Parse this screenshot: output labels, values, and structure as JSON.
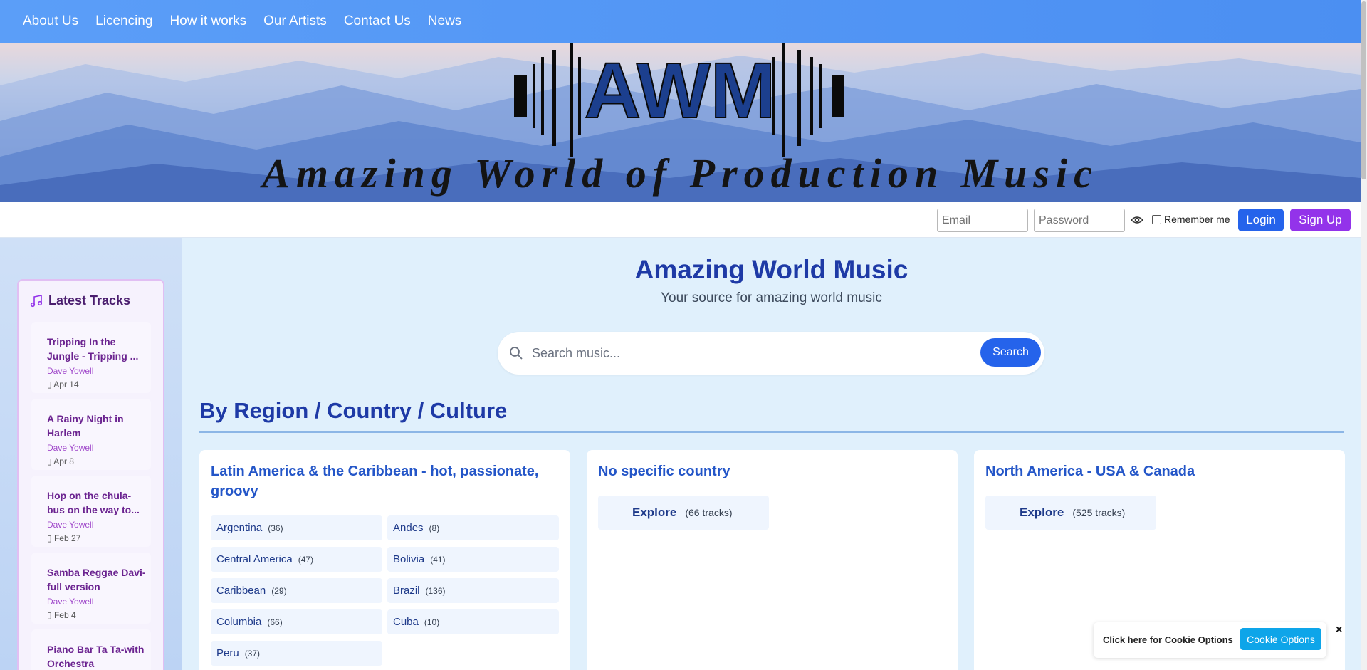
{
  "nav": {
    "items": [
      "About Us",
      "Licencing",
      "How it works",
      "Our Artists",
      "Contact Us",
      "News"
    ]
  },
  "banner": {
    "logo_letters": "AWM",
    "title": "Amazing World of Production Music"
  },
  "login": {
    "email_placeholder": "Email",
    "password_placeholder": "Password",
    "remember_label": "Remember me",
    "login_label": "Login",
    "signup_label": "Sign Up"
  },
  "sidebar": {
    "title": "Latest Tracks",
    "tracks": [
      {
        "title": "Tripping In the Jungle - Tripping ...",
        "artist": "Dave Yowell",
        "date": "Apr 14"
      },
      {
        "title": "A Rainy Night in Harlem",
        "artist": "Dave Yowell",
        "date": "Apr 8"
      },
      {
        "title": "Hop on the chula-bus on the way to...",
        "artist": "Dave Yowell",
        "date": "Feb 27"
      },
      {
        "title": "Samba Reggae Davi-full version",
        "artist": "Dave Yowell",
        "date": "Feb 4"
      },
      {
        "title": "Piano Bar Ta Ta-with Orchestra",
        "artist": "",
        "date": ""
      }
    ]
  },
  "main": {
    "title": "Amazing World Music",
    "subtitle": "Your source for amazing world music",
    "search_placeholder": "Search music...",
    "search_button": "Search",
    "section_title": "By Region / Country / Culture",
    "cards": [
      {
        "title": "Latin America & the Caribbean - hot, passionate, groovy",
        "chips": [
          {
            "name": "Argentina",
            "count": "(36)"
          },
          {
            "name": "Andes",
            "count": "(8)"
          },
          {
            "name": "Central America",
            "count": "(47)"
          },
          {
            "name": "Bolivia",
            "count": "(41)"
          },
          {
            "name": "Caribbean",
            "count": "(29)"
          },
          {
            "name": "Brazil",
            "count": "(136)"
          },
          {
            "name": "Columbia",
            "count": "(66)"
          },
          {
            "name": "Cuba",
            "count": "(10)"
          },
          {
            "name": "Peru",
            "count": "(37)"
          }
        ]
      },
      {
        "title": "No specific country",
        "explore_label": "Explore",
        "count": "(66 tracks)"
      },
      {
        "title": "North America - USA & Canada",
        "explore_label": "Explore",
        "count": "(525 tracks)"
      }
    ]
  },
  "cookie": {
    "text": "Click here for Cookie Options",
    "button": "Cookie Options",
    "close": "×"
  }
}
